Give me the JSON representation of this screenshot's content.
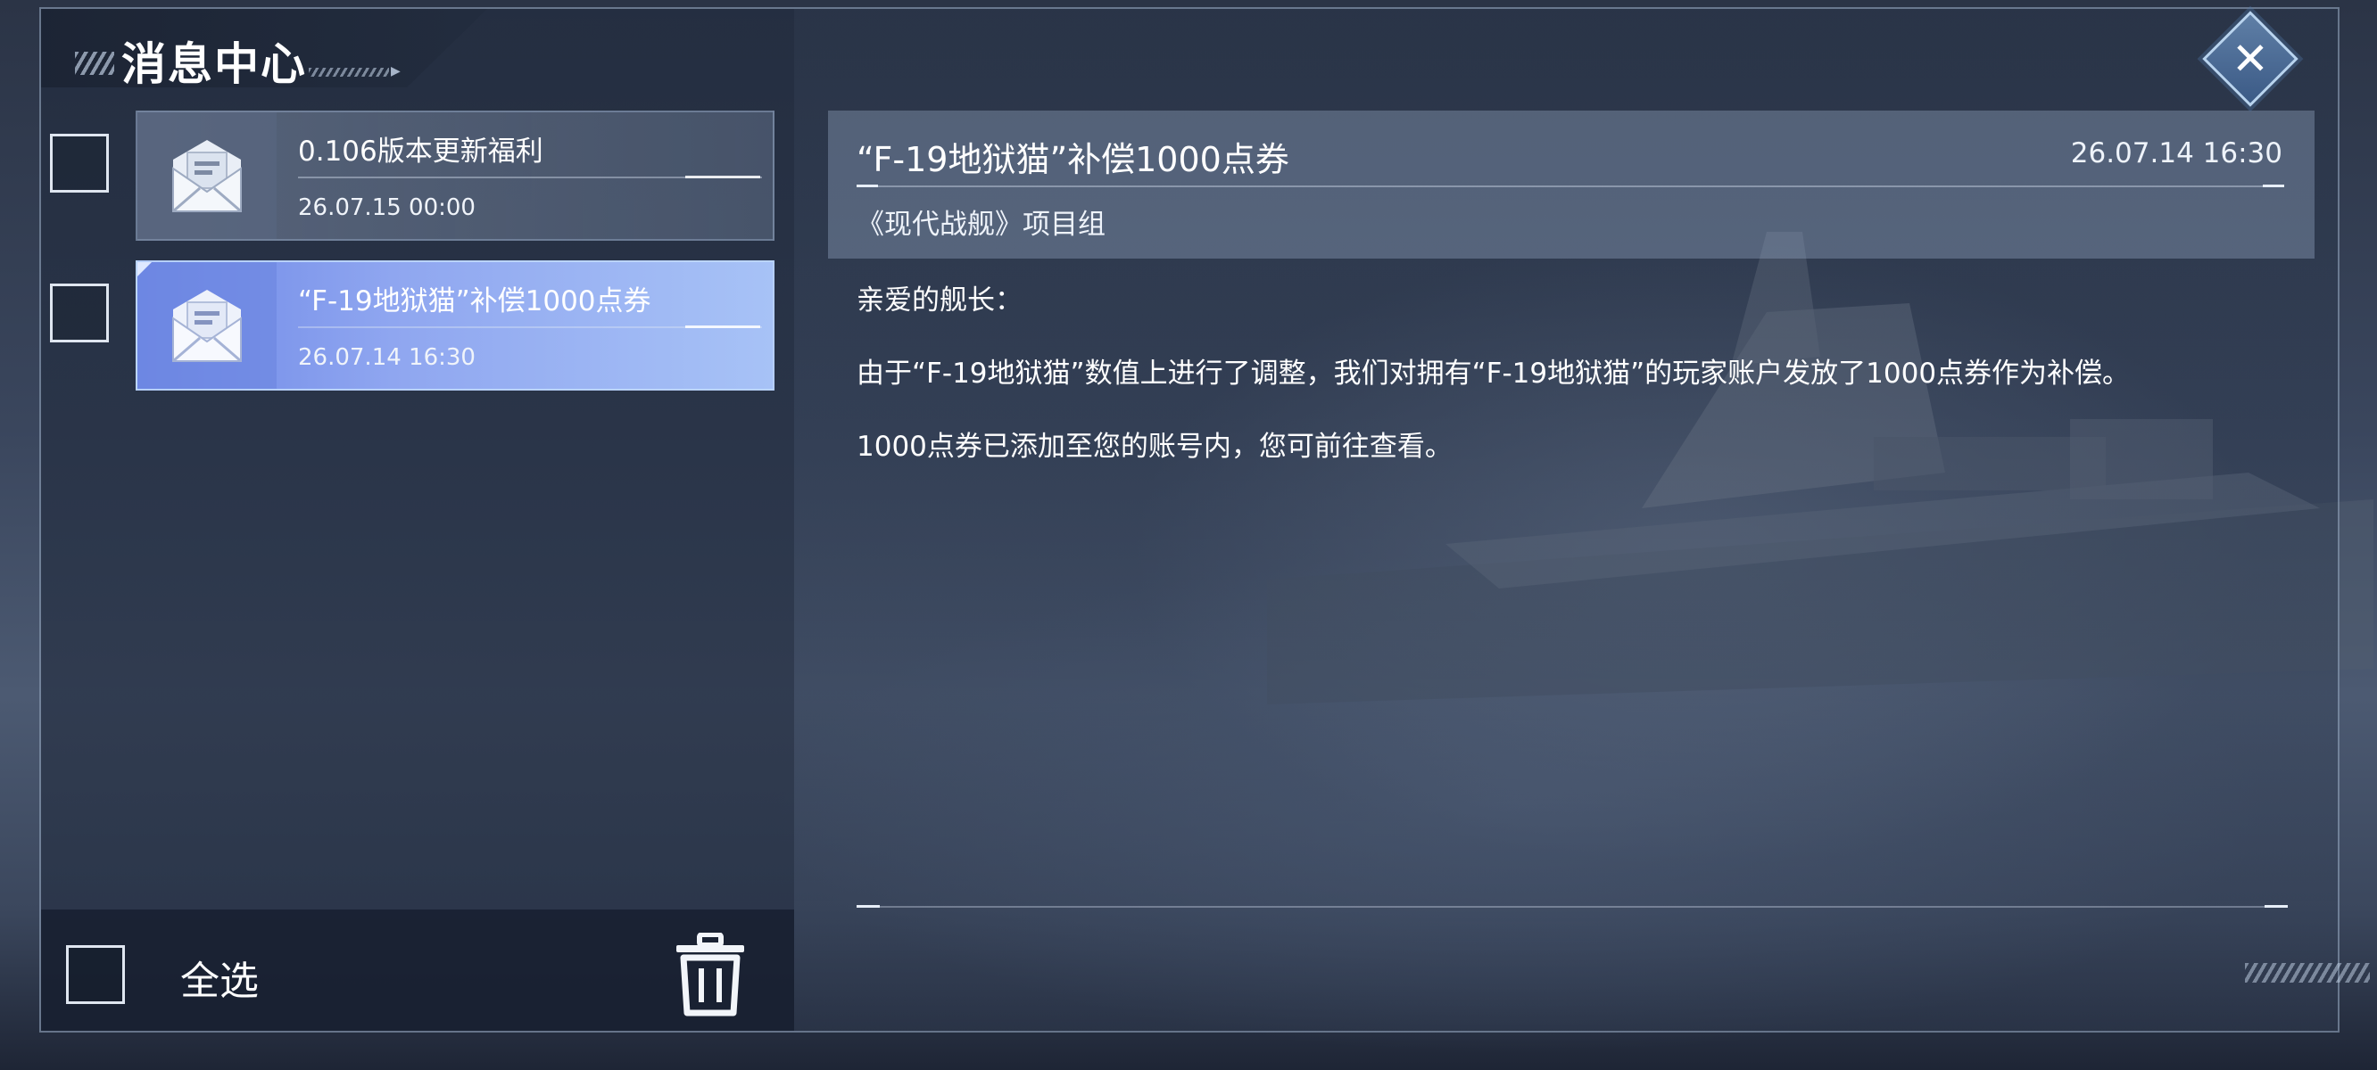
{
  "header": {
    "title": "消息中心"
  },
  "messages": [
    {
      "title": "0.106版本更新福利",
      "date": "26.07.15 00:00",
      "selected": false
    },
    {
      "title": "“F-19地狱猫”补偿1000点券",
      "date": "26.07.14 16:30",
      "selected": true
    }
  ],
  "footer": {
    "select_all_label": "全选"
  },
  "detail": {
    "title": "“F-19地狱猫”补偿1000点券",
    "date": "26.07.14 16:30",
    "sender": "《现代战舰》项目组",
    "greeting": "亲爱的舰长：",
    "paragraph1": "由于“F-19地狱猫”数值上进行了调整，我们对拥有“F-19地狱猫”的玩家账户发放了1000点券作为补偿。",
    "paragraph2": "1000点券已添加至您的账号内，您可前往查看。"
  },
  "icons": {
    "close": "close-icon",
    "mail": "mail-icon",
    "delete": "trash-icon"
  },
  "colors": {
    "selected_card": "#8fa6f0",
    "close_button": "#4a6b95"
  }
}
